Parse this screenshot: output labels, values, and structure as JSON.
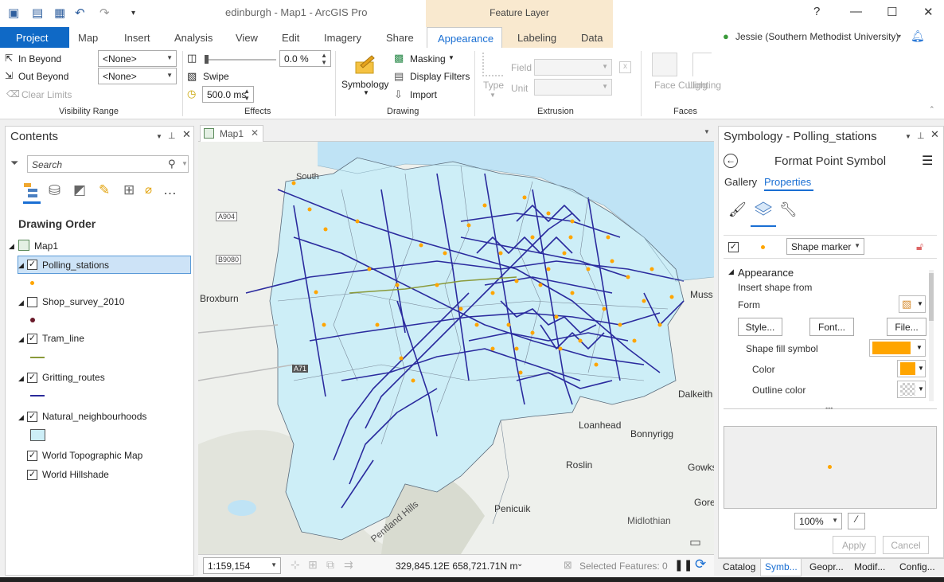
{
  "app": {
    "doc_title": "edinburgh - Map1 - ArcGIS Pro",
    "contextual_tab": "Feature Layer",
    "user": "Jessie (Southern Methodist University)",
    "help": "?",
    "minimize": "—",
    "maximize": "☐",
    "close": "✕"
  },
  "tabs": [
    "Project",
    "Map",
    "Insert",
    "Analysis",
    "View",
    "Edit",
    "Imagery",
    "Share",
    "Appearance",
    "Labeling",
    "Data"
  ],
  "ribbon": {
    "visibility": {
      "in_beyond": "In Beyond",
      "out_beyond": "Out Beyond",
      "clear_limits": "Clear Limits",
      "in_value": "<None>",
      "out_value": "<None>",
      "label": "Visibility Range"
    },
    "effects": {
      "transparency": "0.0 %",
      "swipe": "Swipe",
      "flicker": "500.0  ms",
      "label": "Effects"
    },
    "drawing": {
      "symbology": "Symbology",
      "masking": "Masking",
      "display_filters": "Display Filters",
      "import": "Import",
      "label": "Drawing"
    },
    "extrusion": {
      "type": "Type",
      "field": "Field",
      "unit": "Unit",
      "label": "Extrusion"
    },
    "faces": {
      "face_culling": "Face Culling",
      "lighting": "Lighting",
      "label": "Faces"
    }
  },
  "contents": {
    "title": "Contents",
    "search_placeholder": "Search",
    "drawing_order": "Drawing Order",
    "map": "Map1",
    "layers": [
      {
        "name": "Polling_stations",
        "checked": true
      },
      {
        "name": "Shop_survey_2010",
        "checked": false
      },
      {
        "name": "Tram_line",
        "checked": true
      },
      {
        "name": "Gritting_routes",
        "checked": true
      },
      {
        "name": "Natural_neighbourhoods",
        "checked": true
      },
      {
        "name": "World Topographic Map",
        "checked": true
      },
      {
        "name": "World Hillshade",
        "checked": true
      }
    ]
  },
  "map": {
    "tab": "Map1",
    "labels": {
      "south": "South",
      "a904": "A904",
      "b9080": "B9080",
      "broxburn": "Broxburn",
      "a71": "A71",
      "dalkeith": "Dalkeith",
      "loanhead": "Loanhead",
      "bonnyrigg": "Bonnyrigg",
      "roslin": "Roslin",
      "gowks": "Gowks",
      "gore": "Gore",
      "penicuik": "Penicuik",
      "midlothian": "Midlothian",
      "pentland": "Pentland Hills",
      "muss": "Muss"
    },
    "scale": "1:159,154",
    "coords": "329,845.12E 658,721.71N m",
    "selected": "Selected Features: 0"
  },
  "symbology": {
    "title": "Symbology - Polling_stations",
    "subtitle": "Format Point Symbol",
    "tab_gallery": "Gallery",
    "tab_properties": "Properties",
    "marker_type": "Shape marker",
    "appearance": "Appearance",
    "insert_shape": "Insert shape from",
    "form": "Form",
    "style_btn": "Style...",
    "font_btn": "Font...",
    "file_btn": "File...",
    "fill_symbol": "Shape fill symbol",
    "color": "Color",
    "outline_color": "Outline color",
    "zoom": "100%",
    "apply": "Apply",
    "cancel": "Cancel",
    "fill_hex": "#ffa500"
  },
  "bottom_tabs": [
    "Catalog",
    "Symb...",
    "Geopr...",
    "Modif...",
    "Config..."
  ]
}
